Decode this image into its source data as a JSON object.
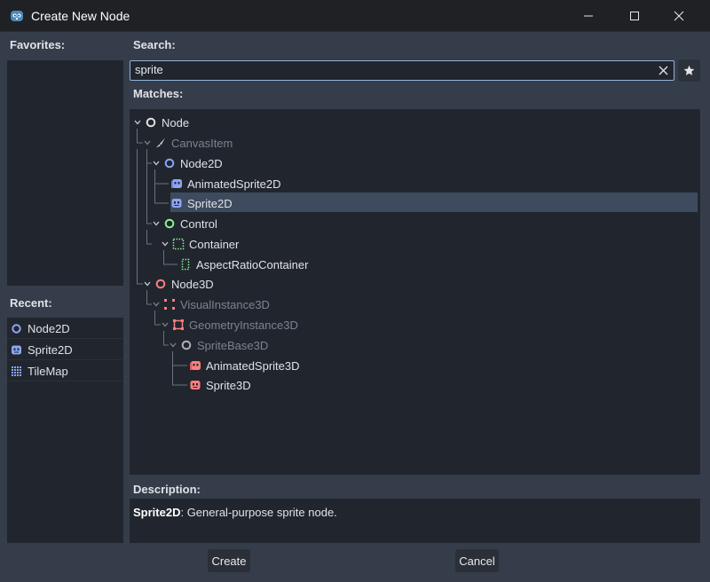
{
  "window": {
    "title": "Create New Node"
  },
  "favorites": {
    "label": "Favorites:"
  },
  "recent": {
    "label": "Recent:",
    "items": [
      {
        "label": "Node2D",
        "icon": "node2d-icon"
      },
      {
        "label": "Sprite2D",
        "icon": "sprite2d-icon"
      },
      {
        "label": "TileMap",
        "icon": "tilemap-icon"
      }
    ]
  },
  "search": {
    "label": "Search:",
    "value": "sprite"
  },
  "matches": {
    "label": "Matches:",
    "tree": [
      {
        "label": "Node",
        "depth": 0,
        "dim": false,
        "icon": "node-icon"
      },
      {
        "label": "CanvasItem",
        "depth": 1,
        "dim": true,
        "icon": "canvasitem-icon"
      },
      {
        "label": "Node2D",
        "depth": 2,
        "dim": false,
        "icon": "node2d-icon"
      },
      {
        "label": "AnimatedSprite2D",
        "depth": 3,
        "dim": false,
        "icon": "animatedsprite2d-icon"
      },
      {
        "label": "Sprite2D",
        "depth": 3,
        "dim": false,
        "icon": "sprite2d-icon",
        "selected": true
      },
      {
        "label": "Control",
        "depth": 2,
        "dim": false,
        "icon": "control-icon"
      },
      {
        "label": "Container",
        "depth": 3,
        "dim": false,
        "icon": "container-icon"
      },
      {
        "label": "AspectRatioContainer",
        "depth": 4,
        "dim": false,
        "icon": "aspectratiocontainer-icon"
      },
      {
        "label": "Node3D",
        "depth": 1,
        "dim": false,
        "icon": "node3d-icon"
      },
      {
        "label": "VisualInstance3D",
        "depth": 2,
        "dim": true,
        "icon": "visualinstance3d-icon"
      },
      {
        "label": "GeometryInstance3D",
        "depth": 3,
        "dim": true,
        "icon": "geometryinstance3d-icon"
      },
      {
        "label": "SpriteBase3D",
        "depth": 4,
        "dim": true,
        "icon": "spritebase3d-icon"
      },
      {
        "label": "AnimatedSprite3D",
        "depth": 5,
        "dim": false,
        "icon": "animatedsprite3d-icon"
      },
      {
        "label": "Sprite3D",
        "depth": 5,
        "dim": false,
        "icon": "sprite3d-icon"
      }
    ]
  },
  "description": {
    "label": "Description:",
    "name": "Sprite2D",
    "text": ": General-purpose sprite node."
  },
  "buttons": {
    "create": "Create",
    "cancel": "Cancel"
  },
  "colors": {
    "accent": "#8fb3d6",
    "node2d": "#8da5f3",
    "control": "#8eef97",
    "node3d": "#fc7f7f"
  }
}
